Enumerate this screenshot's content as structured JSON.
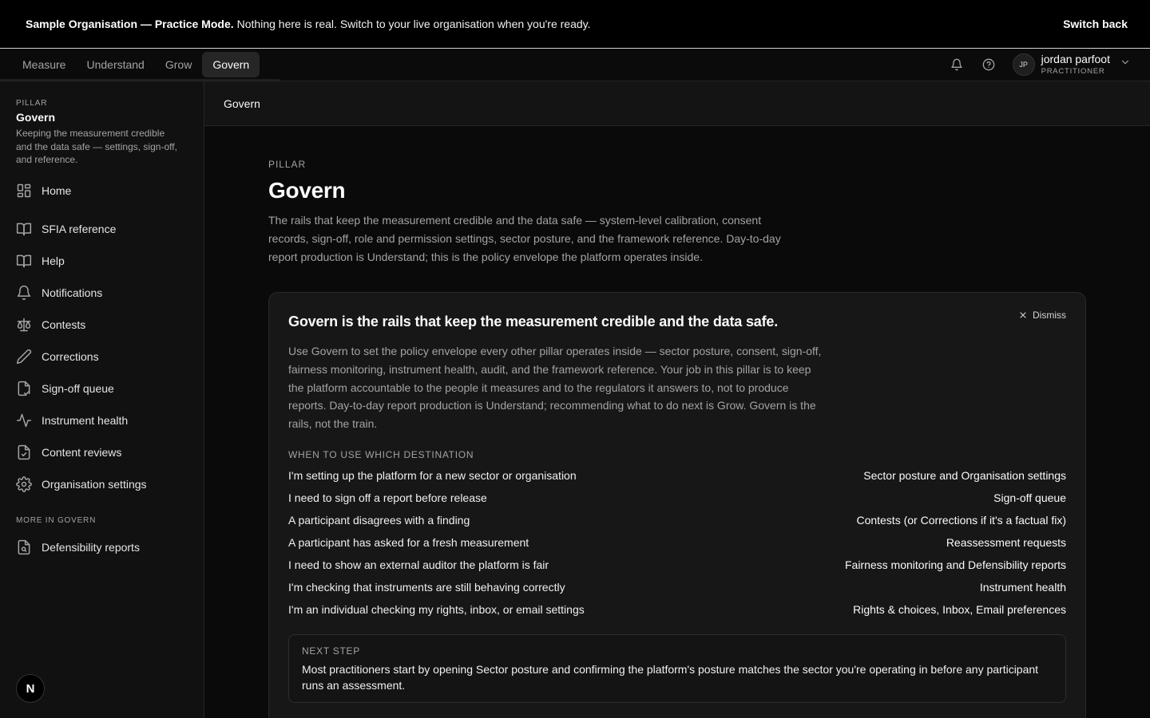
{
  "banner": {
    "title": "Sample Organisation — Practice Mode.",
    "message": "Nothing here is real. Switch to your live organisation when you're ready.",
    "switch_label": "Switch back"
  },
  "topnav": {
    "tabs": [
      {
        "label": "Measure"
      },
      {
        "label": "Understand"
      },
      {
        "label": "Grow"
      },
      {
        "label": "Govern",
        "active": true
      }
    ],
    "user": {
      "initials": "JP",
      "name": "jordan parfoot",
      "role": "PRACTITIONER"
    }
  },
  "sidebar": {
    "eyebrow": "PILLAR",
    "title": "Govern",
    "description": "Keeping the measurement credible and the data safe — settings, sign-off, and reference.",
    "items": [
      {
        "label": "Home",
        "icon": "dashboard-grid-icon"
      },
      {
        "label": "SFIA reference",
        "icon": "book-icon"
      },
      {
        "label": "Help",
        "icon": "book-icon"
      },
      {
        "label": "Notifications",
        "icon": "bell-icon"
      },
      {
        "label": "Contests",
        "icon": "scales-icon"
      },
      {
        "label": "Corrections",
        "icon": "pencil-icon"
      },
      {
        "label": "Sign-off queue",
        "icon": "file-signature-icon"
      },
      {
        "label": "Instrument health",
        "icon": "activity-pulse-icon"
      },
      {
        "label": "Content reviews",
        "icon": "file-review-icon"
      },
      {
        "label": "Organisation settings",
        "icon": "gear-icon"
      }
    ],
    "more_heading": "MORE IN GOVERN",
    "more_items": [
      {
        "label": "Defensibility reports",
        "icon": "file-search-icon"
      }
    ],
    "logo_letter": "N"
  },
  "breadcrumb": {
    "current": "Govern"
  },
  "main": {
    "eyebrow": "PILLAR",
    "title": "Govern",
    "lead": "The rails that keep the measurement credible and the data safe — system-level calibration, consent records, sign-off, role and permission settings, sector posture, and the framework reference. Day-to-day report production is Understand; this is the policy envelope the platform operates inside."
  },
  "card": {
    "title": "Govern is the rails that keep the measurement credible and the data safe.",
    "dismiss_label": "Dismiss",
    "body": "Use Govern to set the policy envelope every other pillar operates inside — sector posture, consent, sign-off, fairness monitoring, instrument health, audit, and the framework reference. Your job in this pillar is to keep the platform accountable to the people it measures and to the regulators it answers to, not to produce reports. Day-to-day report production is Understand; recommending what to do next is Grow. Govern is the rails, not the train.",
    "which_heading": "WHEN TO USE WHICH DESTINATION",
    "rows": [
      {
        "situation": "I'm setting up the platform for a new sector or organisation",
        "destination": "Sector posture and Organisation settings"
      },
      {
        "situation": "I need to sign off a report before release",
        "destination": "Sign-off queue"
      },
      {
        "situation": "A participant disagrees with a finding",
        "destination": "Contests (or Corrections if it's a factual fix)"
      },
      {
        "situation": "A participant has asked for a fresh measurement",
        "destination": "Reassessment requests"
      },
      {
        "situation": "I need to show an external auditor the platform is fair",
        "destination": "Fairness monitoring and Defensibility reports"
      },
      {
        "situation": "I'm checking that instruments are still behaving correctly",
        "destination": "Instrument health"
      },
      {
        "situation": "I'm an individual checking my rights, inbox, or email settings",
        "destination": "Rights & choices, Inbox, Email preferences"
      }
    ],
    "next_step": {
      "label": "NEXT STEP",
      "text": "Most practitioners start by opening Sector posture and confirming the platform's posture matches the sector you're operating in before any participant runs an assessment."
    }
  }
}
